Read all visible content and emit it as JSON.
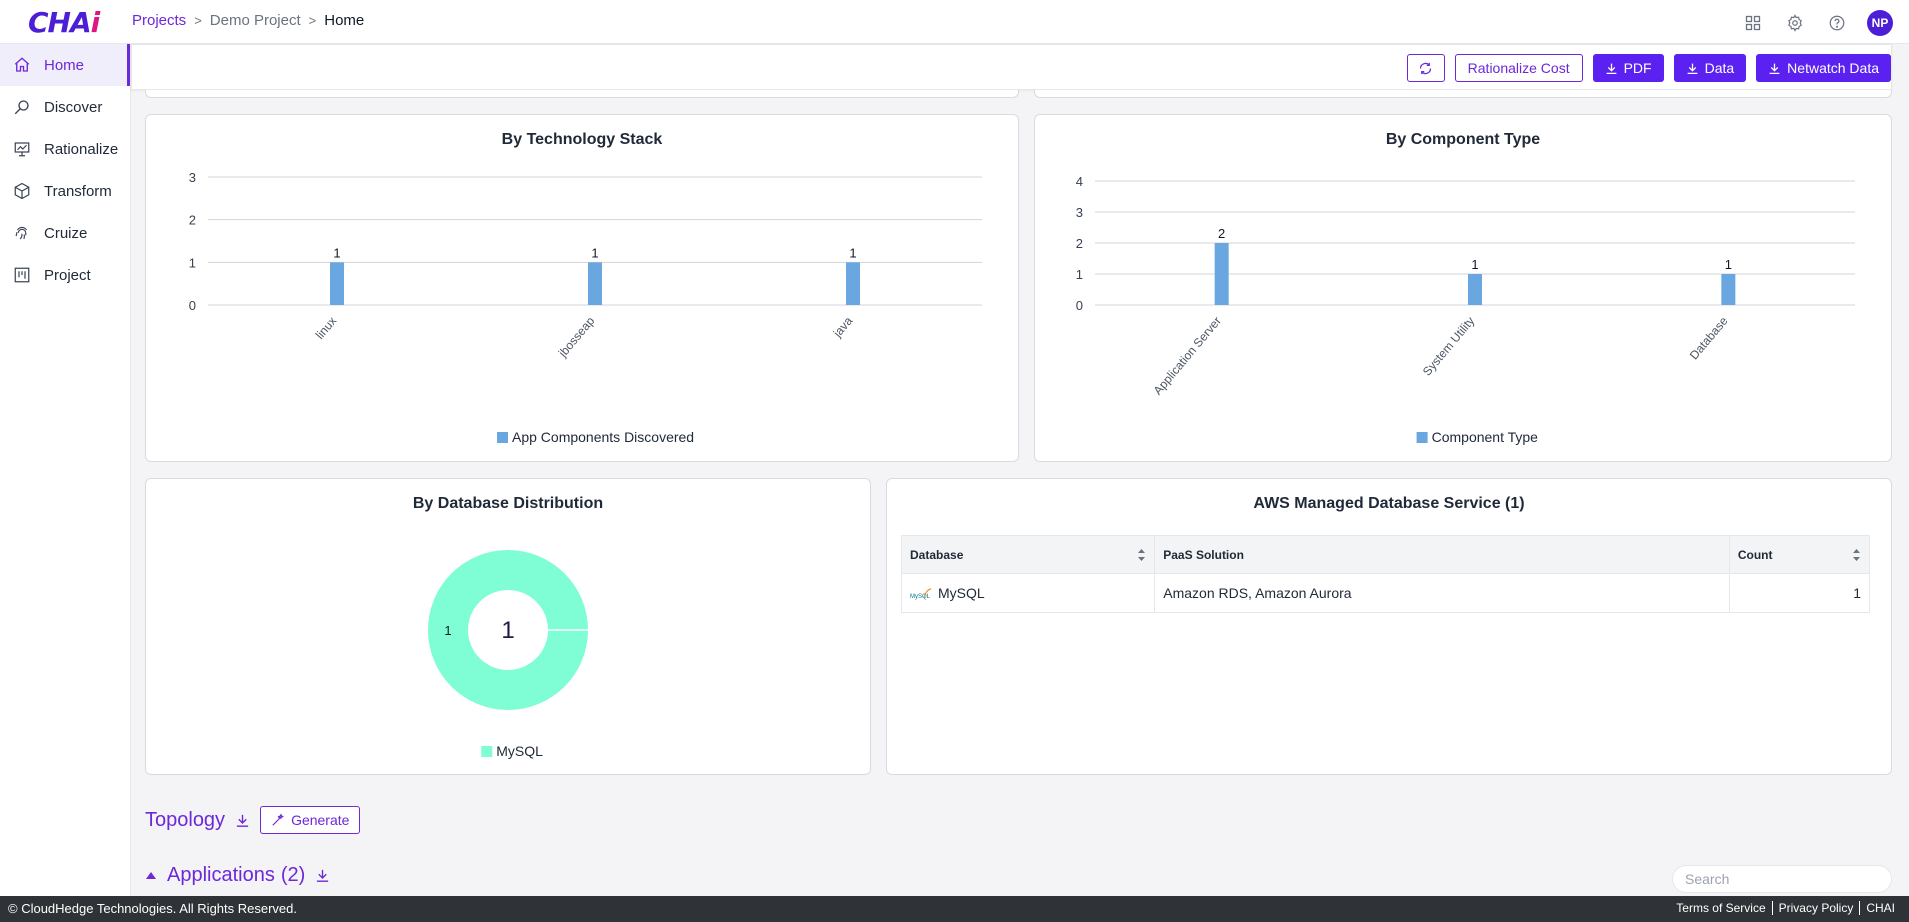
{
  "header": {
    "logo": {
      "main": "CHA",
      "accent": "i"
    },
    "breadcrumb": {
      "root": "Projects",
      "project": "Demo Project",
      "current": "Home"
    },
    "avatar_initials": "NP"
  },
  "sidebar": {
    "items": [
      {
        "label": "Home",
        "icon": "home-icon",
        "active": true
      },
      {
        "label": "Discover",
        "icon": "discover-icon"
      },
      {
        "label": "Rationalize",
        "icon": "rationalize-icon"
      },
      {
        "label": "Transform",
        "icon": "cube-icon"
      },
      {
        "label": "Cruize",
        "icon": "fingerprint-icon"
      },
      {
        "label": "Project",
        "icon": "kanban-icon"
      }
    ]
  },
  "toolbar": {
    "rationalize_label": "Rationalize Cost",
    "pdf_label": "PDF",
    "data_label": "Data",
    "netwatch_label": "Netwatch Data"
  },
  "colors": {
    "accent": "#6d28d9",
    "bar": "#6aa6e0",
    "donut": "#7ffdd4",
    "footer": "#2f3236"
  },
  "tech_card": {
    "title": "By Technology Stack"
  },
  "component_card": {
    "title": "By Component Type"
  },
  "db_card": {
    "title": "By Database Distribution"
  },
  "aws_card": {
    "title": "AWS Managed Database Service (1)",
    "columns": [
      "Database",
      "PaaS Solution",
      "Count"
    ],
    "rows": [
      {
        "database": "MySQL",
        "paas": "Amazon RDS, Amazon Aurora",
        "count": "1",
        "logo_text": "MySQL"
      }
    ]
  },
  "chart_data": [
    {
      "type": "bar",
      "title": "By Technology Stack",
      "categories": [
        "linux",
        "jbosseap",
        "java"
      ],
      "series": [
        {
          "name": "App Components Discovered",
          "values": [
            1,
            1,
            1
          ]
        }
      ],
      "ylim": [
        0,
        3
      ],
      "yticks": [
        0,
        1,
        2,
        3
      ],
      "legend": "bottom",
      "grid": true
    },
    {
      "type": "bar",
      "title": "By Component Type",
      "categories": [
        "Application Server",
        "System Utility",
        "Database"
      ],
      "series": [
        {
          "name": "Component Type",
          "values": [
            2,
            1,
            1
          ]
        }
      ],
      "ylim": [
        0,
        4
      ],
      "yticks": [
        0,
        1,
        2,
        3,
        4
      ],
      "legend": "bottom",
      "grid": true
    },
    {
      "type": "pie",
      "title": "By Database Distribution",
      "labels": [
        "MySQL"
      ],
      "values": [
        1
      ],
      "center_label": "1",
      "legend": "bottom"
    }
  ],
  "sections": {
    "topology": "Topology",
    "generate_label": "Generate",
    "applications": "Applications",
    "applications_count": "(2)",
    "search_placeholder": "Search"
  },
  "footer": {
    "copyright": "© CloudHedge Technologies. All Rights Reserved.",
    "links": [
      "Terms of Service",
      "Privacy Policy",
      "CHAI"
    ]
  }
}
